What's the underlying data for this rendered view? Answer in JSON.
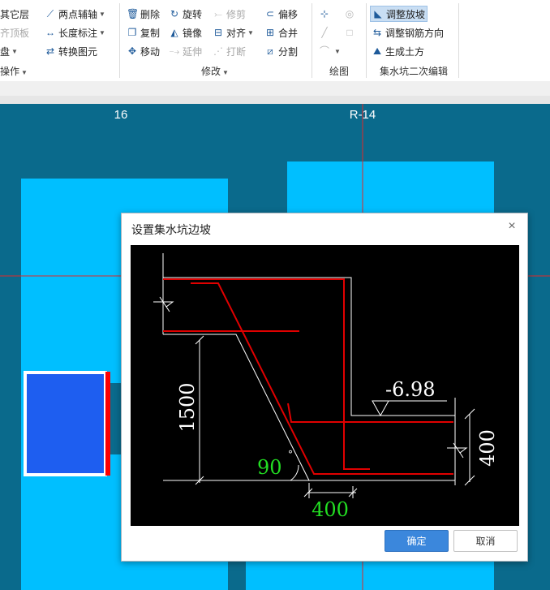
{
  "ribbon": {
    "g1": {
      "rows": [
        [
          {
            "label": "其它层",
            "icon": "layer-icon"
          },
          {
            "label": "两点辅轴",
            "icon": "axis-icon",
            "dropdown": true
          }
        ],
        [
          {
            "label": "齐顶板",
            "icon": "align-top-icon",
            "disabled": true
          },
          {
            "label": "长度标注",
            "icon": "dimension-icon",
            "dropdown": true
          }
        ],
        [
          {
            "label": "盘",
            "icon": "plate-icon",
            "dropdown": true
          },
          {
            "label": "转换图元",
            "icon": "convert-icon"
          }
        ]
      ],
      "title": "操作"
    },
    "modify": {
      "col1": [
        {
          "label": "删除",
          "icon": "delete-icon"
        },
        {
          "label": "复制",
          "icon": "copy-icon"
        },
        {
          "label": "移动",
          "icon": "move-icon"
        }
      ],
      "col2": [
        {
          "label": "旋转",
          "icon": "rotate-icon"
        },
        {
          "label": "镜像",
          "icon": "mirror-icon"
        },
        {
          "label": "延伸",
          "icon": "extend-icon",
          "disabled": true
        }
      ],
      "col3": [
        {
          "label": "修剪",
          "icon": "trim-icon",
          "disabled": true
        },
        {
          "label": "对齐",
          "icon": "align-icon",
          "dropdown": true
        },
        {
          "label": "打断",
          "icon": "break-icon",
          "disabled": true
        }
      ],
      "col4": [
        {
          "label": "偏移",
          "icon": "offset-icon"
        },
        {
          "label": "合并",
          "icon": "merge-icon"
        },
        {
          "label": "分割",
          "icon": "split-icon"
        }
      ],
      "title": "修改"
    },
    "draw": {
      "title": "绘图"
    },
    "pit": {
      "items": [
        {
          "label": "调整放坡",
          "icon": "slope-icon",
          "selected": true
        },
        {
          "label": "调整钢筋方向",
          "icon": "rebar-direction-icon"
        },
        {
          "label": "生成土方",
          "icon": "earthwork-icon"
        }
      ],
      "title": "集水坑二次编辑"
    }
  },
  "canvas": {
    "axis_labels": [
      "16",
      "R-14"
    ],
    "colors": {
      "background": "#0a6a8c",
      "slab": "#00bfff",
      "selected_block": "#1e5ef0",
      "axis": "#e0282a"
    }
  },
  "dialog": {
    "title": "设置集水坑边坡",
    "close_icon": "×",
    "preview": {
      "elevation": "-6.98",
      "depth": "1500",
      "angle": "90",
      "degree_symbol": "°",
      "width": "400",
      "thickness": "400",
      "colors": {
        "background": "#000000",
        "line": "#ffffff",
        "rebar": "#e00000",
        "editable_value": "#22dd22"
      }
    },
    "ok_label": "确定",
    "cancel_label": "取消"
  }
}
